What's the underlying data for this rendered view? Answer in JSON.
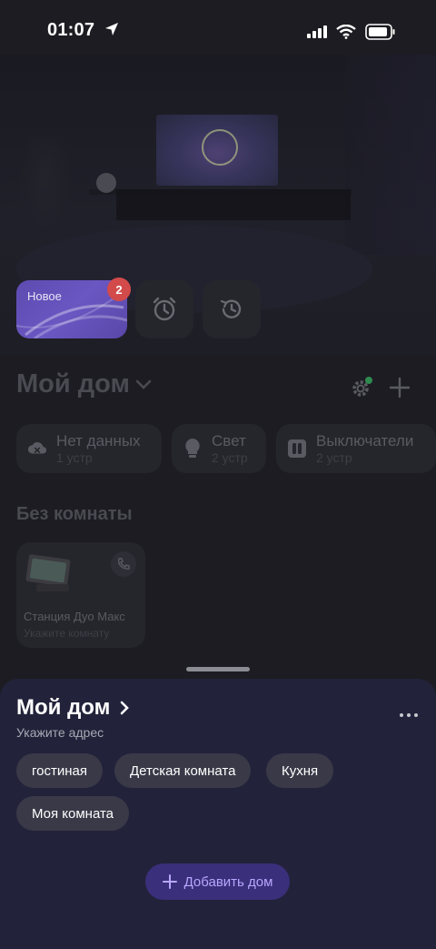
{
  "status_bar": {
    "time": "01:07"
  },
  "stories": {
    "new_label": "Новое",
    "new_badge": "2"
  },
  "home": {
    "title": "Мой дом",
    "chips": [
      {
        "label": "Нет данных",
        "sub": "1 устр",
        "icon": "cloud-off-icon"
      },
      {
        "label": "Свет",
        "sub": "2 устр",
        "icon": "lightbulb-icon"
      },
      {
        "label": "Выключатели",
        "sub": "2 устр",
        "icon": "switch-icon"
      }
    ],
    "section_title": "Без комнаты",
    "device": {
      "name": "Станция Дуо Макс",
      "room": "Укажите комнату"
    }
  },
  "sheet": {
    "title": "Мой дом",
    "subtitle": "Укажите адрес",
    "rooms": [
      "гостиная",
      "Детская комната",
      "Кухня",
      "Моя комната"
    ],
    "add_home_label": "Добавить дом"
  },
  "colors": {
    "accent": "#b8a6ff",
    "sheet_bg": "#22223a",
    "badge": "#d24a4a"
  }
}
